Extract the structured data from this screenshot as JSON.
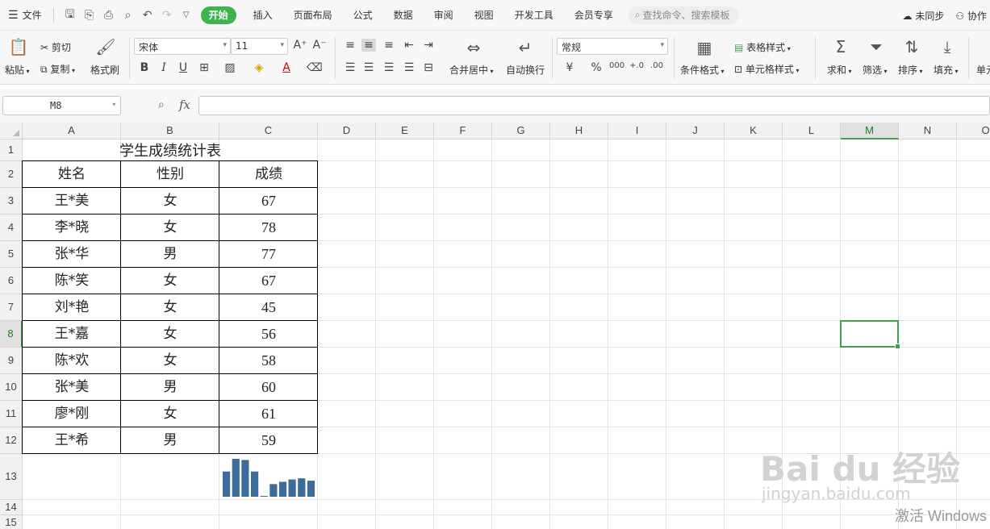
{
  "menubar": {
    "file_label": "文件",
    "tabs": [
      "开始",
      "插入",
      "页面布局",
      "公式",
      "数据",
      "审阅",
      "视图",
      "开发工具",
      "会员专享"
    ],
    "active_tab": "开始",
    "search_placeholder": "查找命令、搜索模板",
    "sync_label": "未同步",
    "collab_label": "协作"
  },
  "ribbon": {
    "paste": "粘贴",
    "cut": "剪切",
    "copy": "复制",
    "format_painter": "格式刷",
    "font_name": "宋体",
    "font_size": "11",
    "bold": "B",
    "italic": "I",
    "underline": "U",
    "merge_center": "合并居中",
    "wrap_text": "自动换行",
    "number_format": "常规",
    "currency": "¥",
    "percent": "%",
    "thousands": "000",
    "cond_format": "条件格式",
    "table_style": "表格样式",
    "cell_style": "单元格样式",
    "sum": "求和",
    "filter": "筛选",
    "sort": "排序",
    "fill": "填充",
    "cell_partial": "单元"
  },
  "formula_bar": {
    "name_box": "M8",
    "fx": "fx",
    "formula": ""
  },
  "sheet": {
    "columns": [
      "A",
      "B",
      "C",
      "D",
      "E",
      "F",
      "G",
      "H",
      "I",
      "J",
      "K",
      "L",
      "M",
      "N",
      "O"
    ],
    "rows": [
      "1",
      "2",
      "3",
      "4",
      "5",
      "6",
      "7",
      "8",
      "9",
      "10",
      "11",
      "12",
      "13",
      "14",
      "15"
    ],
    "selected_cell": "M8",
    "title": "学生成绩统计表",
    "headers": [
      "姓名",
      "性别",
      "成绩"
    ],
    "records": [
      [
        "王*美",
        "女",
        "67"
      ],
      [
        "李*晓",
        "女",
        "78"
      ],
      [
        "张*华",
        "男",
        "77"
      ],
      [
        "陈*笑",
        "女",
        "67"
      ],
      [
        "刘*艳",
        "女",
        "45"
      ],
      [
        "王*嘉",
        "女",
        "56"
      ],
      [
        "陈*欢",
        "女",
        "58"
      ],
      [
        "张*美",
        "男",
        "60"
      ],
      [
        "廖*刚",
        "女",
        "61"
      ],
      [
        "王*希",
        "男",
        "59"
      ]
    ],
    "sparkline_color": "#3d6b9a"
  },
  "watermark": {
    "brand": "Bai du 经验",
    "url": "jingyan.baidu.com"
  },
  "os_notice": "激活 Windows"
}
